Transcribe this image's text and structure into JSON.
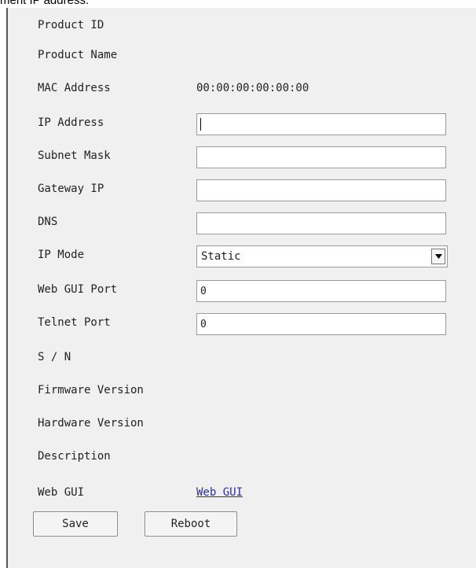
{
  "header": {
    "fragment": "ment IP address."
  },
  "form": {
    "product_id_label": "Product ID",
    "product_name_label": "Product Name",
    "mac_label": "MAC Address",
    "mac_value": "00:00:00:00:00:00",
    "ip_label": "IP Address",
    "ip_value": "",
    "subnet_label": "Subnet Mask",
    "subnet_value": "",
    "gateway_label": "Gateway IP",
    "gateway_value": "",
    "dns_label": "DNS",
    "dns_value": "",
    "ip_mode_label": "IP Mode",
    "ip_mode_value": "Static",
    "web_port_label": "Web GUI Port",
    "web_port_value": "0",
    "telnet_port_label": "Telnet Port",
    "telnet_port_value": "0",
    "sn_label": "S / N",
    "firmware_label": "Firmware Version",
    "hardware_label": "Hardware Version",
    "description_label": "Description",
    "web_gui_label": "Web GUI",
    "web_gui_link": "Web GUI"
  },
  "buttons": {
    "save": "Save",
    "reboot": "Reboot"
  },
  "icons": {
    "select_arrow": "chevron-down-icon"
  },
  "colors": {
    "panel_bg": "#f0f0f0",
    "link": "#2a2aa8"
  }
}
